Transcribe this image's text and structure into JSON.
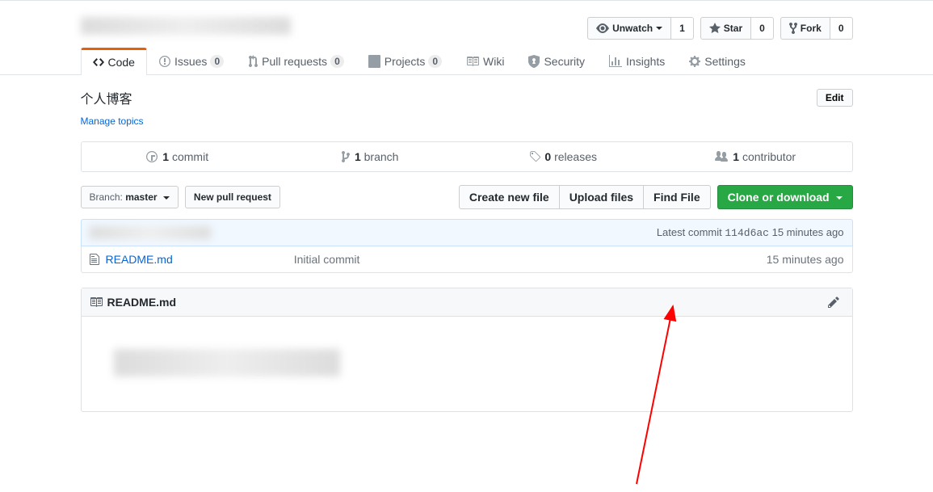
{
  "header": {
    "actions": {
      "unwatch": {
        "label": "Unwatch",
        "count": "1"
      },
      "star": {
        "label": "Star",
        "count": "0"
      },
      "fork": {
        "label": "Fork",
        "count": "0"
      }
    }
  },
  "tabs": {
    "code": "Code",
    "issues": {
      "label": "Issues",
      "count": "0"
    },
    "pulls": {
      "label": "Pull requests",
      "count": "0"
    },
    "projects": {
      "label": "Projects",
      "count": "0"
    },
    "wiki": "Wiki",
    "security": "Security",
    "insights": "Insights",
    "settings": "Settings"
  },
  "description": {
    "text": "个人博客",
    "edit": "Edit",
    "manage_topics": "Manage topics"
  },
  "stats": {
    "commits": {
      "count": "1",
      "label": "commit"
    },
    "branches": {
      "count": "1",
      "label": "branch"
    },
    "releases": {
      "count": "0",
      "label": "releases"
    },
    "contributors": {
      "count": "1",
      "label": "contributor"
    }
  },
  "file_nav": {
    "branch_label": "Branch:",
    "branch_name": "master",
    "new_pr": "New pull request",
    "create_file": "Create new file",
    "upload": "Upload files",
    "find": "Find File",
    "clone": "Clone or download"
  },
  "commit_tease": {
    "latest_label": "Latest commit",
    "sha": "114d6ac",
    "age": "15 minutes ago"
  },
  "files": [
    {
      "name": "README.md",
      "message": "Initial commit",
      "age": "15 minutes ago"
    }
  ],
  "readme": {
    "filename": "README.md"
  }
}
